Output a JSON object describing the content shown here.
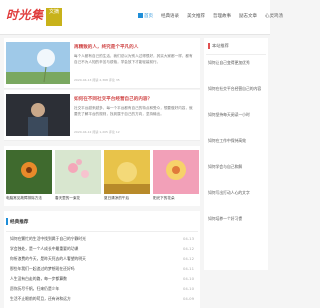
{
  "brand": {
    "logo_text": "时光集",
    "badge_text": "文摘"
  },
  "nav": {
    "items": [
      "首页",
      "经典语录",
      "美文推荐",
      "哲理故事",
      "励志文章",
      "心灵鸡汤"
    ]
  },
  "posts": [
    {
      "title": "再精致的人，终究是个平凡的人",
      "excerpt": "每个人都有自己的生活，我们总以为别人过得很好，其实大家都一样，都有自己不为人知的辛苦与烦恼，学会放下才能轻装前行。",
      "meta": "2020-04-13  阅读 2,368  评论 35"
    },
    {
      "title": "如何在不同社交平台经营自己的内容？",
      "excerpt": "社交平台越来越多，每一个平台都有自己的特点和受众，想要做好内容，就要先了解平台的规则，找到属于自己的方向，坚持输出。",
      "meta": "2020-04-12  阅读 1,205  评论 12"
    }
  ],
  "gallery": [
    {
      "caption": "电脑常见故障排除方法"
    },
    {
      "caption": "春天里的一束花"
    },
    {
      "caption": "夏日清凉的午后"
    },
    {
      "caption": "阳光下的花朵"
    }
  ],
  "section": {
    "title": "经典推荐",
    "items": [
      {
        "text": "如何在繁忙的生活中找到属于自己的宁静时光",
        "date": "04-13"
      },
      {
        "text": "学会独处，是一个人成长中最重要的功课",
        "date": "04-12"
      },
      {
        "text": "你所浪费的今天，是昨天死去的人奢望的明天",
        "date": "04-12"
      },
      {
        "text": "那些年我们一起追过的梦想现在还好吗",
        "date": "04-11"
      },
      {
        "text": "人生没有白走的路，每一步都算数",
        "date": "04-10"
      },
      {
        "text": "愿你历尽千帆，归来仍是少年",
        "date": "04-10"
      },
      {
        "text": "生活不止眼前的苟且，还有诗和远方",
        "date": "04-09"
      }
    ]
  },
  "sidebar": {
    "title": "本站推荐",
    "items": [
      "如何让自己变得更加优秀",
      "如何在社交平台经营自己的内容",
      "如何坚持每天阅读一小时",
      "如何在工作中保持高效",
      "如何学会与自己和解",
      "如何写出打动人心的文字",
      "如何培养一个好习惯"
    ]
  }
}
